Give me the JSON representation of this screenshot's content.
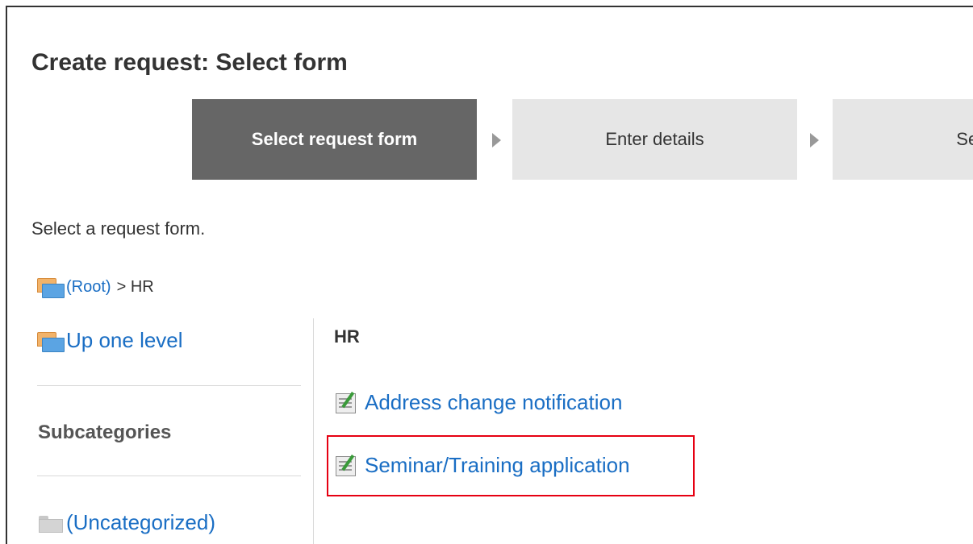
{
  "page": {
    "title": "Create request: Select form",
    "instruction": "Select a request form."
  },
  "steps": [
    {
      "label": "Select request form",
      "state": "active"
    },
    {
      "label": "Enter details",
      "state": "upcoming"
    },
    {
      "label": "Set r",
      "state": "upcoming"
    }
  ],
  "breadcrumb": {
    "icon": "folder-open-icon",
    "root_label": "(Root)",
    "rest": "> HR"
  },
  "sidebar": {
    "up_label": "Up one level",
    "subcategories_heading": "Subcategories",
    "categories": [
      {
        "label": "(Uncategorized)",
        "icon": "folder-gray-icon"
      }
    ]
  },
  "main": {
    "category_heading": "HR",
    "forms": [
      {
        "label": "Address change notification",
        "icon": "form-icon",
        "highlighted": false
      },
      {
        "label": "Seminar/Training application",
        "icon": "form-icon",
        "highlighted": true
      }
    ]
  },
  "colors": {
    "link": "#1a6ec4",
    "step_active_bg": "#666666",
    "step_inactive_bg": "#e6e6e6",
    "highlight_border": "#e60012"
  }
}
